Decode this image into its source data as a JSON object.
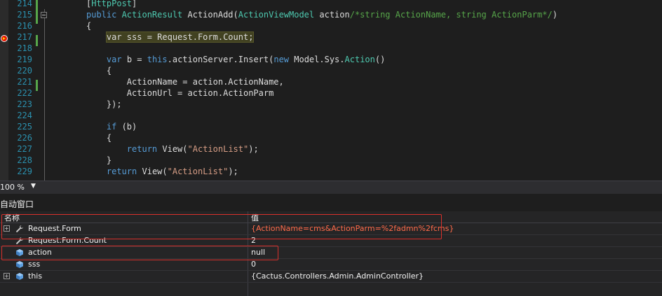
{
  "editor": {
    "lines": [
      {
        "num": "214",
        "tokens": [
          {
            "t": "[",
            "c": ""
          },
          {
            "t": "HttpPost",
            "c": "ty"
          },
          {
            "t": "]",
            "c": ""
          }
        ]
      },
      {
        "num": "215",
        "tokens": [
          {
            "t": "public ",
            "c": "kw"
          },
          {
            "t": "ActionResult",
            "c": "ty"
          },
          {
            "t": " ActionAdd(",
            "c": ""
          },
          {
            "t": "ActionViewModel",
            "c": "ty"
          },
          {
            "t": " action",
            "c": ""
          },
          {
            "t": "/*string ActionName, string ActionParm*/",
            "c": "cm"
          },
          {
            "t": ")",
            "c": ""
          }
        ]
      },
      {
        "num": "216",
        "tokens": [
          {
            "t": "{",
            "c": ""
          }
        ]
      },
      {
        "num": "217",
        "tokens": [
          {
            "t": "    ",
            "c": ""
          },
          {
            "t": "var sss = Request.Form.Count;",
            "c": "hl"
          }
        ]
      },
      {
        "num": "218",
        "tokens": []
      },
      {
        "num": "219",
        "tokens": [
          {
            "t": "    ",
            "c": ""
          },
          {
            "t": "var",
            "c": "kw"
          },
          {
            "t": " b = ",
            "c": ""
          },
          {
            "t": "this",
            "c": "kw"
          },
          {
            "t": ".actionServer.Insert(",
            "c": ""
          },
          {
            "t": "new",
            "c": "kw"
          },
          {
            "t": " Model.Sys.",
            "c": ""
          },
          {
            "t": "Action",
            "c": "ty"
          },
          {
            "t": "()",
            "c": ""
          }
        ]
      },
      {
        "num": "220",
        "tokens": [
          {
            "t": "    {",
            "c": ""
          }
        ]
      },
      {
        "num": "221",
        "tokens": [
          {
            "t": "        ActionName = action.ActionName,",
            "c": ""
          }
        ]
      },
      {
        "num": "222",
        "tokens": [
          {
            "t": "        ActionUrl = action.ActionParm",
            "c": ""
          }
        ]
      },
      {
        "num": "223",
        "tokens": [
          {
            "t": "    });",
            "c": ""
          }
        ]
      },
      {
        "num": "224",
        "tokens": []
      },
      {
        "num": "225",
        "tokens": [
          {
            "t": "    ",
            "c": ""
          },
          {
            "t": "if",
            "c": "kw"
          },
          {
            "t": " (b)",
            "c": ""
          }
        ]
      },
      {
        "num": "226",
        "tokens": [
          {
            "t": "    {",
            "c": ""
          }
        ]
      },
      {
        "num": "227",
        "tokens": [
          {
            "t": "        ",
            "c": ""
          },
          {
            "t": "return",
            "c": "kw"
          },
          {
            "t": " View(",
            "c": ""
          },
          {
            "t": "\"ActionList\"",
            "c": "st"
          },
          {
            "t": ");",
            "c": ""
          }
        ]
      },
      {
        "num": "228",
        "tokens": [
          {
            "t": "    }",
            "c": ""
          }
        ]
      },
      {
        "num": "229",
        "tokens": [
          {
            "t": "    ",
            "c": ""
          },
          {
            "t": "return",
            "c": "kw"
          },
          {
            "t": " View(",
            "c": ""
          },
          {
            "t": "\"ActionList\"",
            "c": "st"
          },
          {
            "t": ");",
            "c": ""
          }
        ]
      }
    ]
  },
  "zoom": {
    "label": "100 %"
  },
  "autos": {
    "title": "自动窗口",
    "col_name": "名称",
    "col_value": "值",
    "rows": [
      {
        "name": "Request.Form",
        "value": "{ActionName=cms&ActionParm=%2fadmn%2fcms}",
        "icon": "wrench-icon",
        "expandable": true,
        "changed": true
      },
      {
        "name": "Request.Form.Count",
        "value": "2",
        "icon": "wrench-icon",
        "expandable": false,
        "changed": false
      },
      {
        "name": "action",
        "value": "null",
        "icon": "local-variable-icon",
        "expandable": false,
        "changed": false
      },
      {
        "name": "sss",
        "value": "0",
        "icon": "local-variable-icon",
        "expandable": false,
        "changed": false
      },
      {
        "name": "this",
        "value": "{Cactus.Controllers.Admin.AdminController}",
        "icon": "local-variable-icon",
        "expandable": true,
        "changed": false
      }
    ]
  },
  "colors": {
    "annotation": "#d9302b",
    "breakpoint": "#e51400",
    "keyword": "#569cd6",
    "type": "#4ec9b0",
    "string": "#d69d85",
    "comment": "#57a64a"
  }
}
